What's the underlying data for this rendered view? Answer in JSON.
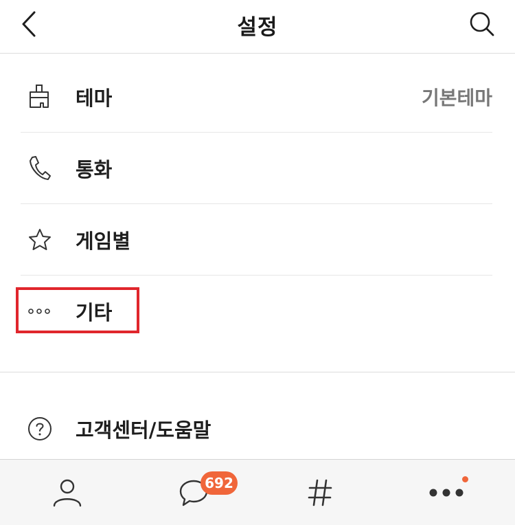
{
  "header": {
    "title": "설정",
    "back_icon": "chevron-left-icon",
    "search_icon": "search-icon"
  },
  "menu": {
    "items": [
      {
        "label": "테마",
        "value": "기본테마",
        "icon": "paintbrush-icon"
      },
      {
        "label": "통화",
        "icon": "phone-icon"
      },
      {
        "label": "게임별",
        "icon": "star-icon"
      },
      {
        "label": "기타",
        "icon": "more-horizontal-icon"
      }
    ],
    "support": {
      "label": "고객센터/도움말",
      "icon": "help-circle-icon"
    }
  },
  "tabbar": {
    "tabs": [
      {
        "icon": "person-icon"
      },
      {
        "icon": "chat-bubble-icon",
        "badge": "692"
      },
      {
        "icon": "hashtag-icon"
      },
      {
        "icon": "more-dots-icon",
        "has_notice_dot": true
      }
    ]
  },
  "colors": {
    "accent": "#f0663a",
    "highlight": "#e0262c",
    "text": "#1e1e1e",
    "secondary_text": "#777777"
  }
}
